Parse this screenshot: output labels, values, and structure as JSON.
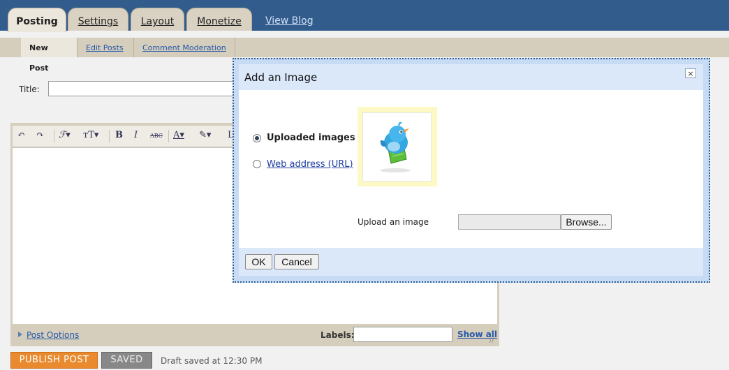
{
  "nav": {
    "tabs": [
      {
        "label": "Posting"
      },
      {
        "label": "Settings"
      },
      {
        "label": "Layout"
      },
      {
        "label": "Monetize"
      }
    ],
    "view_blog": "View Blog"
  },
  "subnav": {
    "items": [
      {
        "label": "New Post"
      },
      {
        "label": "Edit Posts"
      },
      {
        "label": "Comment Moderation"
      }
    ]
  },
  "post": {
    "title_label": "Title:",
    "title_value": ""
  },
  "editor": {
    "post_options": "Post Options",
    "labels_label": "Labels:",
    "labels_value": "",
    "show_all": "Show all"
  },
  "footer": {
    "publish_label": "PUBLISH POST",
    "saved_label": "SAVED",
    "draft_status": "Draft saved at 12:30 PM"
  },
  "dialog": {
    "title": "Add an Image",
    "close_glyph": "×",
    "options": [
      {
        "label": "Uploaded images",
        "selected": true
      },
      {
        "label": "Web address (URL)",
        "selected": false
      }
    ],
    "upload_label": "Upload an image",
    "upload_value": "",
    "browse_label": "Browse...",
    "ok_label": "OK",
    "cancel_label": "Cancel"
  },
  "colors": {
    "header_blue": "#315c8c",
    "tab_beige": "#d9d2c3",
    "link_blue": "#2458a8",
    "publish_orange": "#e98a2e",
    "dialog_blue": "#c7dbf4"
  }
}
